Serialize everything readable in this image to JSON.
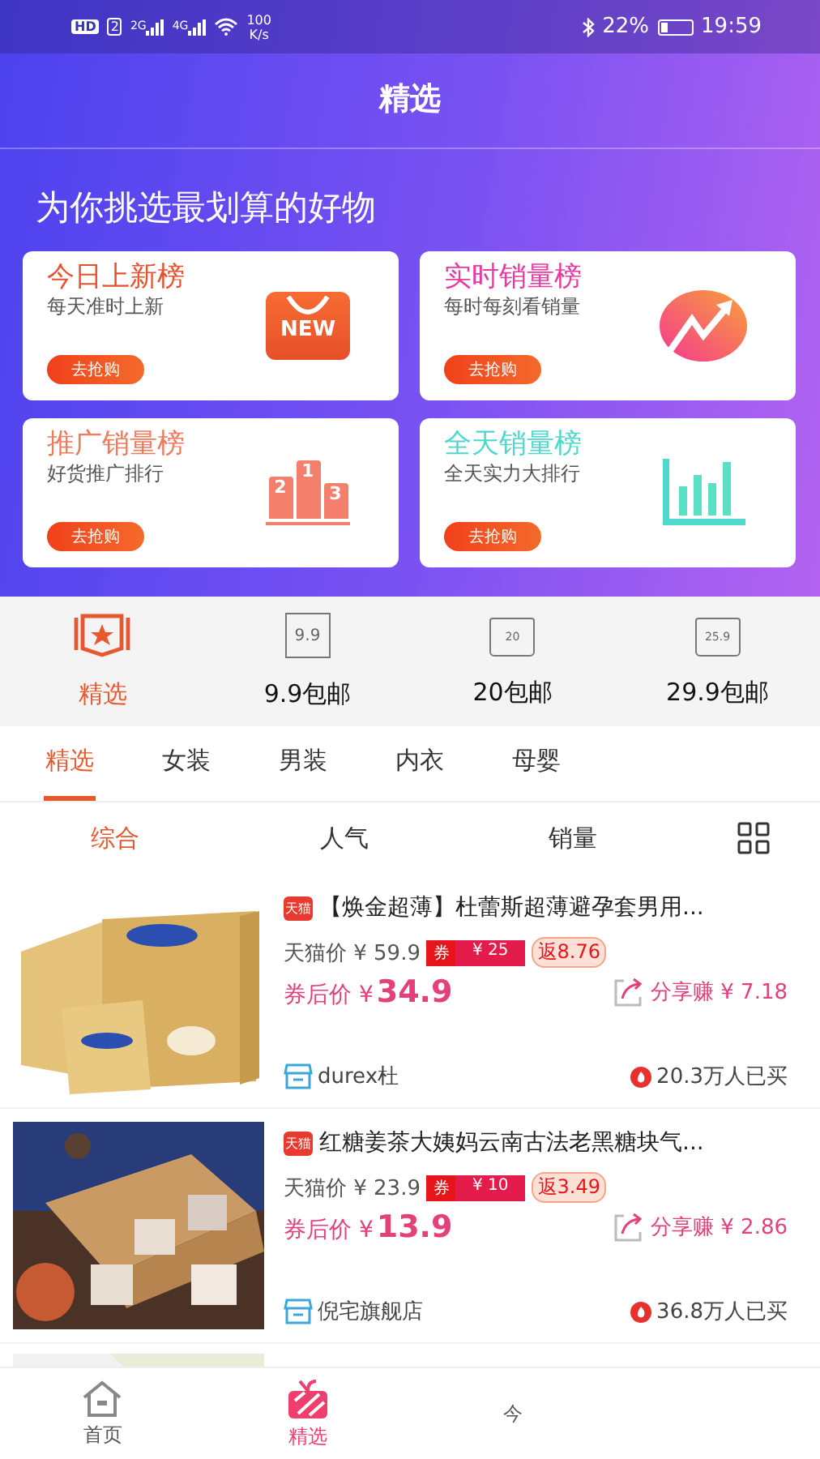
{
  "status_bar": {
    "hd_badge": "HD",
    "sim": "2",
    "networks": [
      "2G",
      "4G"
    ],
    "speed": "100",
    "speed_unit": "K/s",
    "battery_text": "22%",
    "time": "19:59"
  },
  "header": {
    "title": "精选",
    "headline": "为你挑选最划算的好物"
  },
  "rank_cards": [
    {
      "title": "今日上新榜",
      "subtitle": "每天准时上新",
      "button": "去抢购",
      "kind": "new",
      "icon_labels": [
        "NEW"
      ],
      "color": "#e8512e"
    },
    {
      "title": "实时销量榜",
      "subtitle": "每时每刻看销量",
      "button": "去抢购",
      "kind": "trend",
      "color": "#e83aa0"
    },
    {
      "title": "推广销量榜",
      "subtitle": "好货推广排行",
      "button": "去抢购",
      "kind": "podium",
      "icon_labels": [
        "2",
        "1",
        "3"
      ],
      "color": "#f07a5c"
    },
    {
      "title": "全天销量榜",
      "subtitle": "全天实力大排行",
      "button": "去抢购",
      "kind": "chart",
      "color": "#4fd8cc"
    }
  ],
  "quick_links": [
    {
      "label": "精选",
      "kind": "star",
      "selected": true
    },
    {
      "label": "9.9包邮",
      "kind": "tag",
      "icon_label": "9.9",
      "selected": false
    },
    {
      "label": "20包邮",
      "kind": "bag",
      "icon_label": "20",
      "selected": false
    },
    {
      "label": "29.9包邮",
      "kind": "bag",
      "icon_label": "25.9",
      "selected": false
    }
  ],
  "tabs": [
    {
      "label": "精选",
      "selected": true
    },
    {
      "label": "女装",
      "selected": false
    },
    {
      "label": "男装",
      "selected": false
    },
    {
      "label": "内衣",
      "selected": false
    },
    {
      "label": "母婴",
      "selected": false
    }
  ],
  "sort_options": [
    {
      "label": "综合",
      "selected": true
    },
    {
      "label": "人气",
      "selected": false
    },
    {
      "label": "销量",
      "selected": false
    }
  ],
  "products": [
    {
      "platform": "天猫",
      "title": "【焕金超薄】杜蕾斯超薄避孕套男用...",
      "list_price": "天猫价 ¥ 59.9",
      "coupon_label": "券",
      "coupon_value": "¥ 25",
      "rebate": "返8.76",
      "after_label": "券后价 ¥",
      "after_price": "34.9",
      "share": "分享赚 ¥ 7.18",
      "shop": "durex杜",
      "sales": "20.3万人已买"
    },
    {
      "platform": "天猫",
      "title": "红糖姜茶大姨妈云南古法老黑糖块气...",
      "list_price": "天猫价 ¥ 23.9",
      "coupon_label": "券",
      "coupon_value": "¥ 10",
      "rebate": "返3.49",
      "after_label": "券后价 ¥",
      "after_price": "13.9",
      "share": "分享赚 ¥ 2.86",
      "shop": "倪宅旗舰店",
      "sales": "36.8万人已买"
    }
  ],
  "bottom_nav": [
    {
      "label": "首页",
      "kind": "home",
      "selected": false
    },
    {
      "label": "精选",
      "kind": "gift",
      "selected": true
    },
    {
      "label": "今",
      "kind": "none",
      "selected": false
    }
  ]
}
